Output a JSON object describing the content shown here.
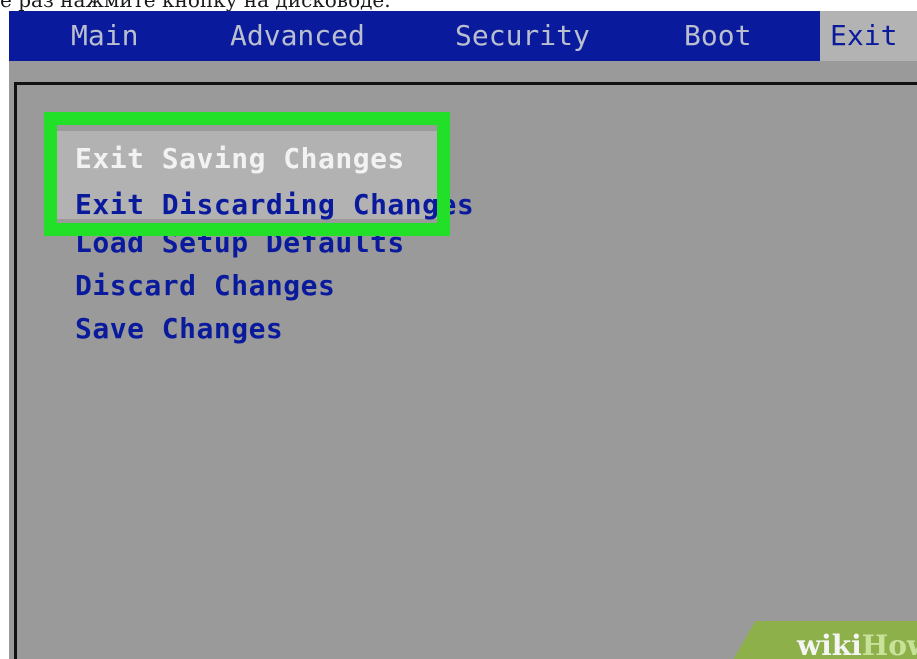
{
  "caption": "е раз нажмите кнопку на дисководе.",
  "menubar": {
    "tabs": [
      "Main",
      "Advanced",
      "Security",
      "Boot",
      "Exit"
    ],
    "active": "Exit"
  },
  "exit_menu": {
    "items": [
      "Exit Saving Changes",
      "Exit Discarding Changes",
      "Load Setup Defaults",
      "Discard Changes",
      "Save Changes"
    ],
    "selected": "Exit Saving Changes"
  },
  "colors": {
    "menubar_bg": "#0a1a9c",
    "screen_bg": "#9a9a9a",
    "item_text": "#0a1a9c",
    "highlight_frame": "#22e028"
  },
  "watermark": {
    "part1": "wiki",
    "part2": "How"
  }
}
